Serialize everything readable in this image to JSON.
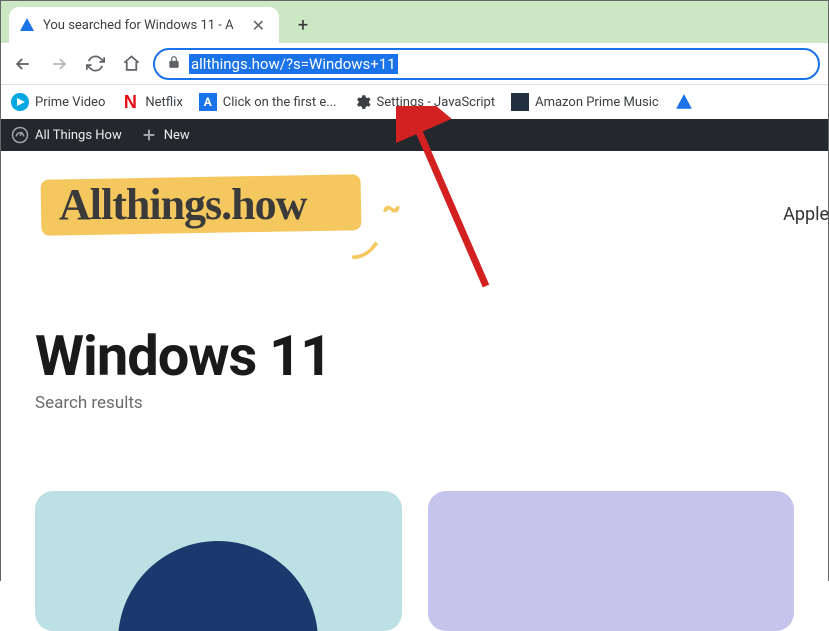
{
  "tab": {
    "title": "You searched for Windows 11 - A"
  },
  "toolbar": {
    "url": "allthings.how/?s=Windows+11"
  },
  "bookmarks": {
    "prime_video": "Prime Video",
    "netflix": "Netflix",
    "click_first": "Click on the first e...",
    "settings_js": "Settings - JavaScript",
    "amazon_music": "Amazon Prime Music"
  },
  "admin_bar": {
    "site_name": "All Things How",
    "new_label": "New"
  },
  "site": {
    "logo_text": "Allthings.how",
    "nav_apple": "Apple"
  },
  "page": {
    "heading": "Windows 11",
    "subtitle": "Search results"
  }
}
